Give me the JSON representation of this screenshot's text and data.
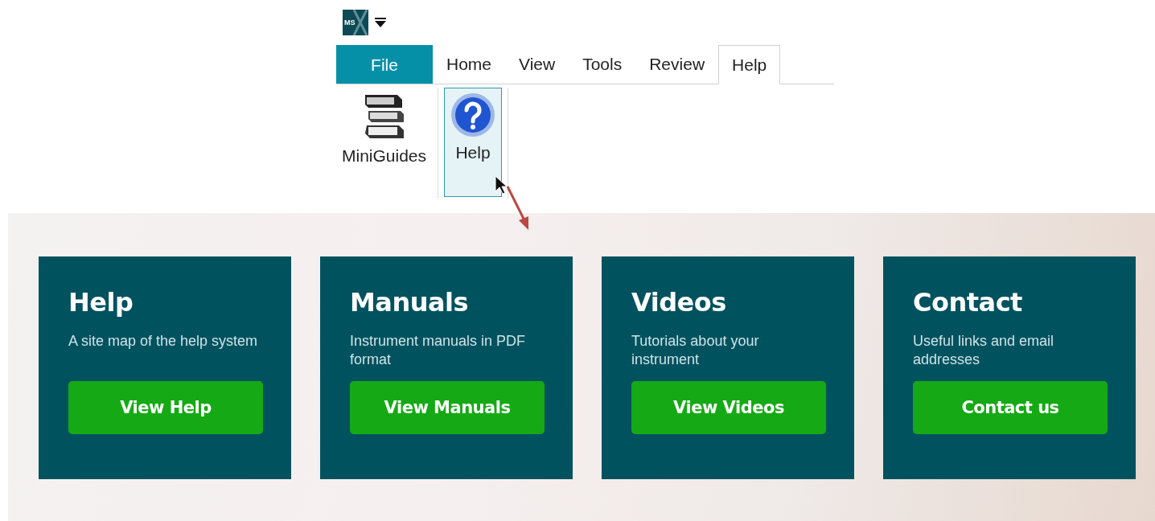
{
  "app_logo": {
    "text": "MS"
  },
  "tabs": [
    {
      "label": "File",
      "kind": "file",
      "selected": false
    },
    {
      "label": "Home",
      "kind": "tab",
      "selected": false
    },
    {
      "label": "View",
      "kind": "tab",
      "selected": false
    },
    {
      "label": "Tools",
      "kind": "tab",
      "selected": false
    },
    {
      "label": "Review",
      "kind": "tab",
      "selected": false
    },
    {
      "label": "Help",
      "kind": "tab",
      "selected": true
    }
  ],
  "ribbon_buttons": [
    {
      "label": "MiniGuides",
      "kind": "books",
      "selected": false
    },
    {
      "label": "Help",
      "kind": "question",
      "selected": true
    }
  ],
  "cards": [
    {
      "title": "Help",
      "description": "A site map of the help system",
      "button": "View Help"
    },
    {
      "title": "Manuals",
      "description": "Instrument manuals in PDF format",
      "button": "View Manuals"
    },
    {
      "title": "Videos",
      "description": "Tutorials about your instrument",
      "button": "View Videos"
    },
    {
      "title": "Contact",
      "description": "Useful links and email addresses",
      "button": "Contact us"
    }
  ]
}
